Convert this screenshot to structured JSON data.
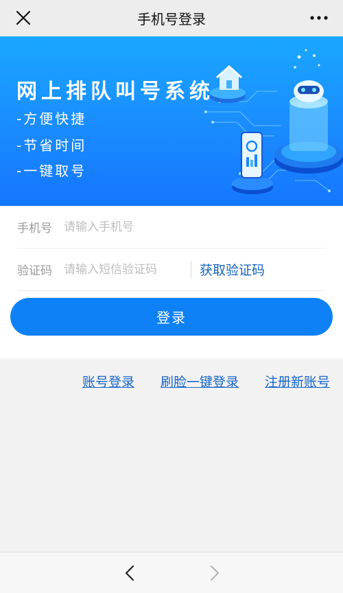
{
  "header": {
    "title": "手机号登录",
    "close_icon": "close-icon",
    "more_icon": "more-dots-icon"
  },
  "banner": {
    "headline": "网上排队叫号系统",
    "features": [
      "-方便快捷",
      "-节省时间",
      "-一键取号"
    ],
    "colors": {
      "gradient_top": "#1aa7ff",
      "gradient_bottom": "#1576ff"
    }
  },
  "form": {
    "phone": {
      "label": "手机号",
      "placeholder": "请输入手机号",
      "value": ""
    },
    "code": {
      "label": "验证码",
      "placeholder": "请输入短信验证码",
      "value": "",
      "get_code_label": "获取验证码"
    },
    "login_label": "登录"
  },
  "links": {
    "account_login": "账号登录",
    "face_login": "刷脸一键登录",
    "register": "注册新账号"
  },
  "footer": {
    "back_icon": "chevron-left-icon",
    "forward_icon": "chevron-right-icon"
  },
  "colors": {
    "accent": "#0e81f6",
    "link": "#1666cc"
  }
}
